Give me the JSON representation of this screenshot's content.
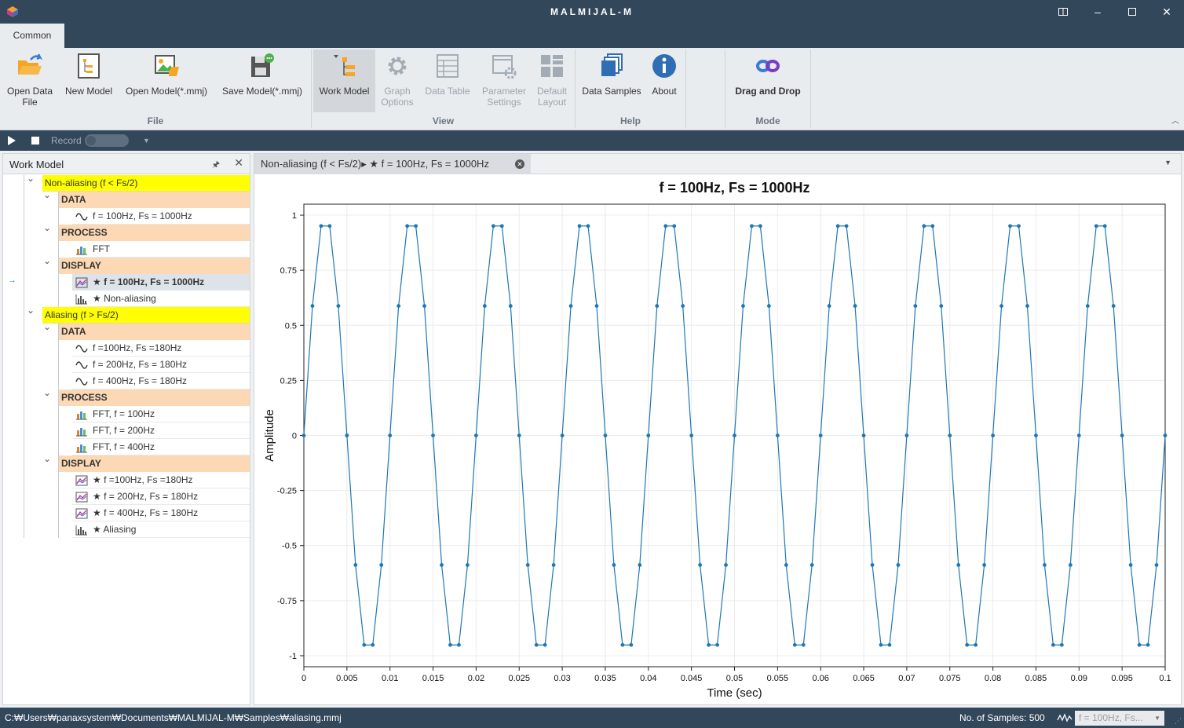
{
  "app": {
    "title": "MALMIJAL-M",
    "window_buttons": [
      "restore-window",
      "minimize",
      "maximize",
      "close"
    ]
  },
  "ribbon": {
    "tab": "Common",
    "groups": {
      "file": "File",
      "view": "View",
      "help": "Help",
      "mode": "Mode"
    },
    "buttons": {
      "open_data_file": "Open Data File",
      "new_model": "New Model",
      "open_model": "Open Model(*.mmj)",
      "save_model": "Save Model(*.mmj)",
      "work_model": "Work Model",
      "graph_options": "Graph Options",
      "data_table": "Data Table",
      "parameter_settings": "Parameter Settings",
      "default_layout": "Default Layout",
      "data_samples": "Data Samples",
      "about": "About",
      "drag_and_drop": "Drag and Drop"
    }
  },
  "recordbar": {
    "record_label": "Record"
  },
  "work_model": {
    "title": "Work Model",
    "tree": [
      {
        "type": "root",
        "label": "Non-aliasing (f < Fs/2)"
      },
      {
        "type": "cat",
        "label": "DATA"
      },
      {
        "type": "item",
        "icon": "wave",
        "label": "f = 100Hz, Fs = 1000Hz"
      },
      {
        "type": "cat",
        "label": "PROCESS"
      },
      {
        "type": "item",
        "icon": "bar",
        "label": "FFT"
      },
      {
        "type": "cat",
        "label": "DISPLAY"
      },
      {
        "type": "item",
        "icon": "line",
        "label": "★ f = 100Hz, Fs = 1000Hz",
        "selected": true
      },
      {
        "type": "item",
        "icon": "hist",
        "label": "★ Non-aliasing"
      },
      {
        "type": "root",
        "label": "Aliasing (f > Fs/2)"
      },
      {
        "type": "cat",
        "label": "DATA"
      },
      {
        "type": "item",
        "icon": "wave",
        "label": "f  =100Hz, Fs =180Hz"
      },
      {
        "type": "item",
        "icon": "wave",
        "label": "f = 200Hz, Fs = 180Hz"
      },
      {
        "type": "item",
        "icon": "wave",
        "label": "f = 400Hz, Fs = 180Hz"
      },
      {
        "type": "cat",
        "label": "PROCESS"
      },
      {
        "type": "item",
        "icon": "bar",
        "label": "FFT, f = 100Hz"
      },
      {
        "type": "item",
        "icon": "bar",
        "label": "FFT, f = 200Hz"
      },
      {
        "type": "item",
        "icon": "bar",
        "label": "FFT, f = 400Hz"
      },
      {
        "type": "cat",
        "label": "DISPLAY"
      },
      {
        "type": "item",
        "icon": "line",
        "label": "★ f  =100Hz, Fs =180Hz"
      },
      {
        "type": "item",
        "icon": "line",
        "label": "★ f = 200Hz, Fs = 180Hz"
      },
      {
        "type": "item",
        "icon": "line",
        "label": "★ f = 400Hz, Fs = 180Hz"
      },
      {
        "type": "item",
        "icon": "hist",
        "label": "★ Aliasing"
      }
    ]
  },
  "document": {
    "tab_label": "Non-aliasing (f < Fs/2)▸ ★ f = 100Hz, Fs = 1000Hz"
  },
  "chart_data": {
    "type": "line",
    "title": "f = 100Hz, Fs = 1000Hz",
    "xlabel": "Time (sec)",
    "ylabel": "Amplitude",
    "xlim": [
      0,
      0.1
    ],
    "ylim": [
      -1.05,
      1.05
    ],
    "x_ticks": [
      "0",
      "0.005",
      "0.01",
      "0.015",
      "0.02",
      "0.025",
      "0.03",
      "0.035",
      "0.04",
      "0.045",
      "0.05",
      "0.055",
      "0.06",
      "0.065",
      "0.07",
      "0.075",
      "0.08",
      "0.085",
      "0.09",
      "0.095",
      "0.1"
    ],
    "y_ticks": [
      "1",
      "0.75",
      "0.5",
      "0.25",
      "0",
      "-0.25",
      "-0.5",
      "-0.75",
      "-1"
    ],
    "grid": true,
    "series": [
      {
        "color": "#1f77b4",
        "x": [
          0,
          0.001,
          0.002,
          0.003,
          0.004,
          0.005,
          0.006,
          0.007,
          0.008,
          0.009,
          0.01,
          0.011,
          0.012,
          0.013,
          0.014,
          0.015,
          0.016,
          0.017,
          0.018,
          0.019,
          0.02,
          0.021,
          0.022,
          0.023,
          0.024,
          0.025,
          0.026,
          0.027,
          0.028,
          0.029,
          0.03,
          0.031,
          0.032,
          0.033,
          0.034,
          0.035,
          0.036,
          0.037,
          0.038,
          0.039,
          0.04,
          0.041,
          0.042,
          0.043,
          0.044,
          0.045,
          0.046,
          0.047,
          0.048,
          0.049,
          0.05,
          0.051,
          0.052,
          0.053,
          0.054,
          0.055,
          0.056,
          0.057,
          0.058,
          0.059,
          0.06,
          0.061,
          0.062,
          0.063,
          0.064,
          0.065,
          0.066,
          0.067,
          0.068,
          0.069,
          0.07,
          0.071,
          0.072,
          0.073,
          0.074,
          0.075,
          0.076,
          0.077,
          0.078,
          0.079,
          0.08,
          0.081,
          0.082,
          0.083,
          0.084,
          0.085,
          0.086,
          0.087,
          0.088,
          0.089,
          0.09,
          0.091,
          0.092,
          0.093,
          0.094,
          0.095,
          0.096,
          0.097,
          0.098,
          0.099,
          0.1
        ],
        "y": [
          0,
          0.588,
          0.951,
          0.951,
          0.588,
          0,
          -0.588,
          -0.951,
          -0.951,
          -0.588,
          0,
          0.588,
          0.951,
          0.951,
          0.588,
          0,
          -0.588,
          -0.951,
          -0.951,
          -0.588,
          0,
          0.588,
          0.951,
          0.951,
          0.588,
          0,
          -0.588,
          -0.951,
          -0.951,
          -0.588,
          0,
          0.588,
          0.951,
          0.951,
          0.588,
          0,
          -0.588,
          -0.951,
          -0.951,
          -0.588,
          0,
          0.588,
          0.951,
          0.951,
          0.588,
          0,
          -0.588,
          -0.951,
          -0.951,
          -0.588,
          0,
          0.588,
          0.951,
          0.951,
          0.588,
          0,
          -0.588,
          -0.951,
          -0.951,
          -0.588,
          0,
          0.588,
          0.951,
          0.951,
          0.588,
          0,
          -0.588,
          -0.951,
          -0.951,
          -0.588,
          0,
          0.588,
          0.951,
          0.951,
          0.588,
          0,
          -0.588,
          -0.951,
          -0.951,
          -0.588,
          0,
          0.588,
          0.951,
          0.951,
          0.588,
          0,
          -0.588,
          -0.951,
          -0.951,
          -0.588,
          0,
          0.588,
          0.951,
          0.951,
          0.588,
          0,
          -0.588,
          -0.951,
          -0.951,
          -0.588,
          0
        ]
      }
    ]
  },
  "status": {
    "path": "C:₩Users₩panaxsystem₩Documents₩MALMIJAL-M₩Samples₩aliasing.mmj",
    "samples": "No. of Samples: 500",
    "combo": "f = 100Hz, Fs..."
  }
}
